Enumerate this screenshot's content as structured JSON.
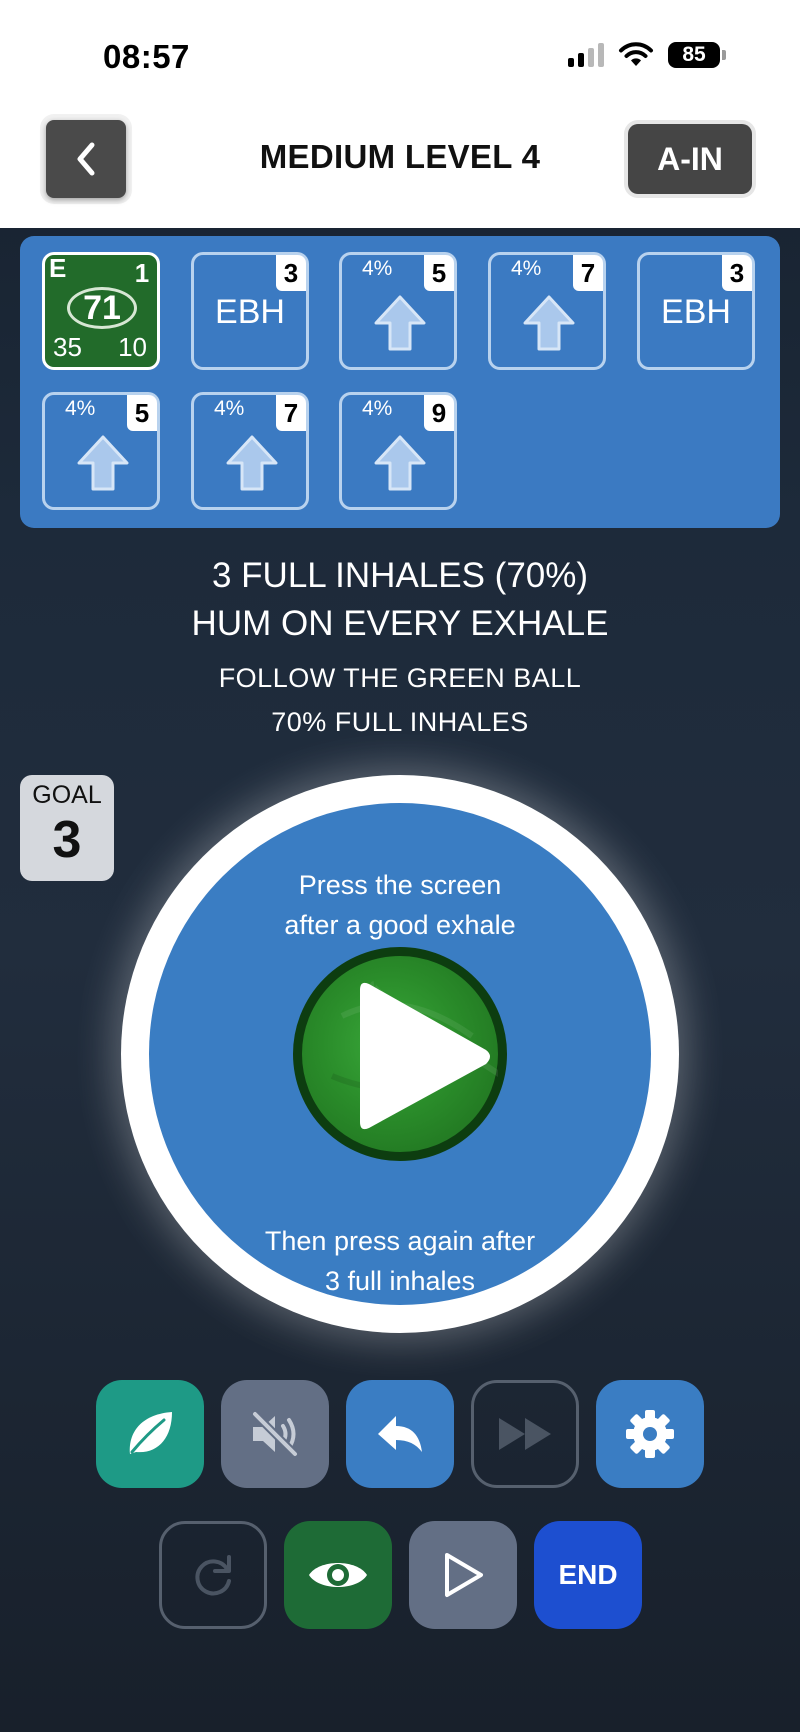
{
  "status_bar": {
    "time": "08:57",
    "battery": "85"
  },
  "header": {
    "title": "MEDIUM LEVEL 4",
    "right_button": "A-IN"
  },
  "cards": [
    {
      "type": "score",
      "letter": "E",
      "number": "1",
      "score": "71",
      "bottom_left": "35",
      "bottom_right": "10",
      "active": true
    },
    {
      "type": "text",
      "label": "EBH",
      "number": "3"
    },
    {
      "type": "arrow",
      "percent": "4%",
      "number": "5"
    },
    {
      "type": "arrow",
      "percent": "4%",
      "number": "7"
    },
    {
      "type": "text",
      "label": "EBH",
      "number": "3"
    },
    {
      "type": "arrow",
      "percent": "4%",
      "number": "5"
    },
    {
      "type": "arrow",
      "percent": "4%",
      "number": "7"
    },
    {
      "type": "arrow",
      "percent": "4%",
      "number": "9"
    }
  ],
  "instructions": {
    "line1": "3 FULL INHALES (70%)",
    "line2": "HUM ON EVERY EXHALE",
    "sub1": "FOLLOW THE GREEN BALL",
    "sub2": "70% FULL INHALES"
  },
  "goal": {
    "label": "GOAL",
    "value": "3"
  },
  "circle": {
    "top_line1": "Press the screen",
    "top_line2": "after a good exhale",
    "bottom_line1": "Then press again after",
    "bottom_line2": "3 full inhales"
  },
  "controls": {
    "row1": [
      "leaf-icon",
      "mute-icon",
      "reply-icon",
      "fast-forward-icon",
      "gear-icon"
    ],
    "row2": [
      "redo-icon",
      "eye-icon",
      "play-outline-icon"
    ],
    "end_label": "END"
  },
  "colors": {
    "panel_blue": "#3b7ac2",
    "active_card_green": "#226b2a",
    "circle_blue": "#3a7dc3",
    "leaf_teal": "#1e9a86",
    "end_blue": "#1d4fd0"
  }
}
